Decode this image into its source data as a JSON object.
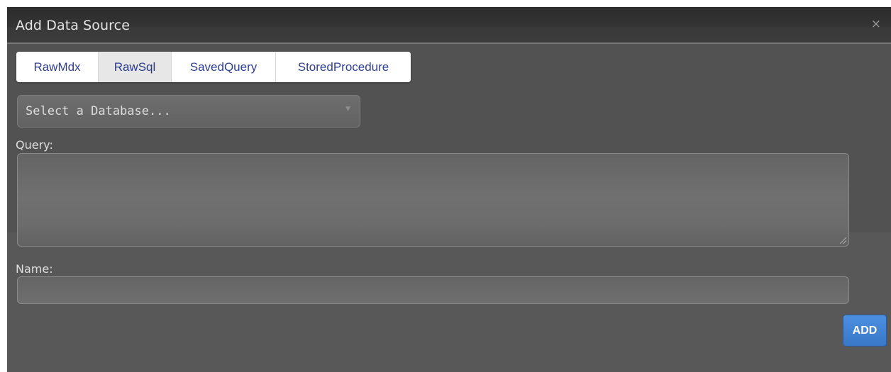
{
  "dialog": {
    "title": "Add Data Source",
    "close_glyph": "×",
    "close_icon": "close-icon"
  },
  "tabs": [
    {
      "label": "RawMdx",
      "active": false
    },
    {
      "label": "RawSql",
      "active": true
    },
    {
      "label": "SavedQuery",
      "active": false
    },
    {
      "label": "StoredProcedure",
      "active": false
    }
  ],
  "database_select": {
    "value": "Select a Database...",
    "arrow_glyph": "▼",
    "arrow_icon": "chevron-down-icon"
  },
  "query": {
    "label": "Query:",
    "value": ""
  },
  "name": {
    "label": "Name:",
    "value": ""
  },
  "actions": {
    "add_label": "ADD"
  },
  "colors": {
    "dialog_bg": "#585858",
    "header_bg": "#343434",
    "tab_text": "#2f3f8f",
    "accent": "#3f82d6"
  }
}
